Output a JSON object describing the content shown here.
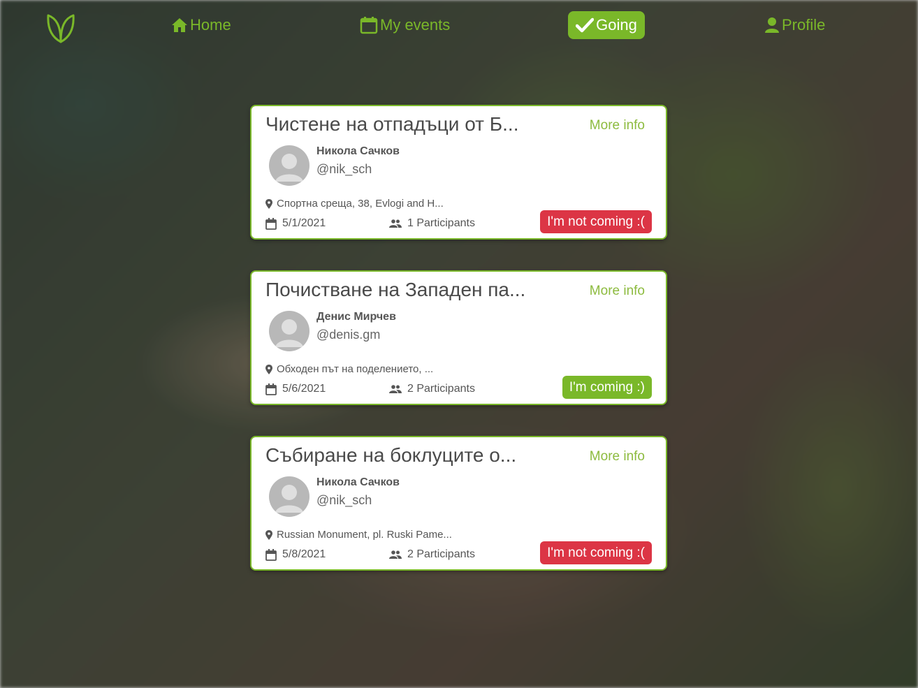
{
  "nav": {
    "logo_icon": "leaf-logo-icon",
    "items": [
      {
        "label": "Home",
        "icon": "home-icon",
        "active": false
      },
      {
        "label": "My events",
        "icon": "calendar-icon",
        "active": false
      },
      {
        "label": "Going",
        "icon": "checkmark-icon",
        "active": true
      },
      {
        "label": "Profile",
        "icon": "user-icon",
        "active": false
      }
    ]
  },
  "colors": {
    "accent": "#7ab829",
    "more_info": "#8dbb3f",
    "danger": "#dc3545"
  },
  "events": [
    {
      "title": "Чистене на отпадъци от Б...",
      "more_info": "More info",
      "author_name": "Никола Сачков",
      "author_handle": "@nik_sch",
      "location": "Спортна среща, 38, Evlogi and H...",
      "date": "5/1/2021",
      "participants": "1 Participants",
      "rsvp_label": "I'm not coming :(",
      "rsvp_state": "going"
    },
    {
      "title": "Почистване на Западен па...",
      "more_info": "More info",
      "author_name": "Денис Мирчев",
      "author_handle": "@denis.gm",
      "location": "Обходен път на поделението, ...",
      "date": "5/6/2021",
      "participants": "2 Participants",
      "rsvp_label": "I'm coming :)",
      "rsvp_state": "not-going"
    },
    {
      "title": "Събиране на боклуците о...",
      "more_info": "More info",
      "author_name": "Никола Сачков",
      "author_handle": "@nik_sch",
      "location": "Russian Monument, pl. Ruski Pame...",
      "date": "5/8/2021",
      "participants": "2 Participants",
      "rsvp_label": "I'm not coming :(",
      "rsvp_state": "going"
    }
  ]
}
